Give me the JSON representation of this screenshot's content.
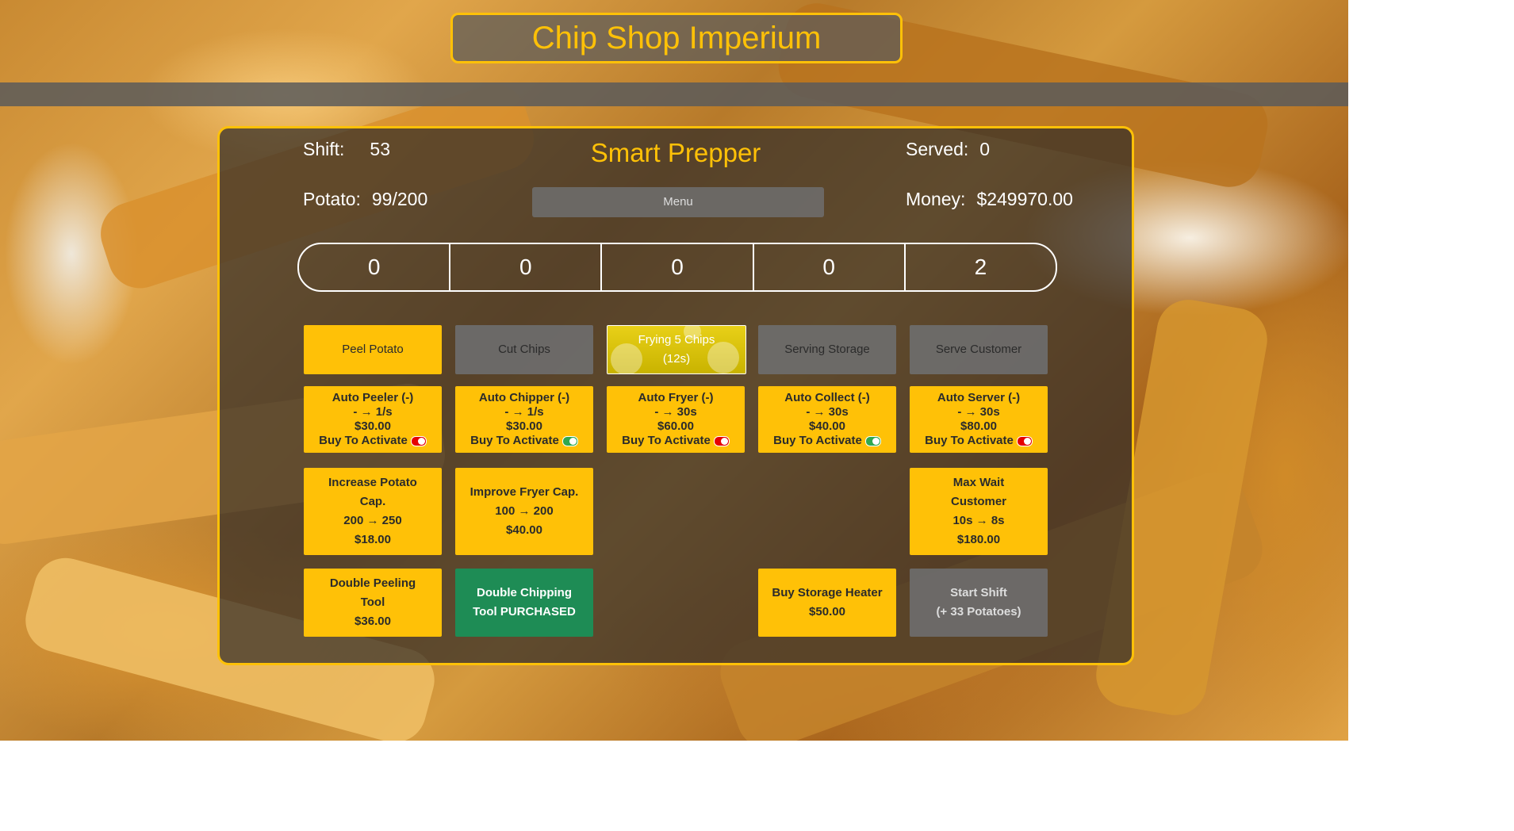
{
  "app": {
    "title": "Chip Shop Imperium"
  },
  "game": {
    "subtitle": "Smart Prepper",
    "shift_label": "Shift:",
    "shift_value": "53",
    "potato_label": "Potato:",
    "potato_value": "99/200",
    "served_label": "Served:",
    "served_value": "0",
    "money_label": "Money:",
    "money_value": "$249970.00",
    "menu_label": "Menu"
  },
  "counters": [
    "0",
    "0",
    "0",
    "0",
    "2"
  ],
  "actions": {
    "peel": "Peel Potato",
    "cut": "Cut Chips",
    "fry_line1": "Frying 5 Chips",
    "fry_line2": "(12s)",
    "storage": "Serving Storage",
    "serve": "Serve Customer"
  },
  "automation": [
    {
      "name": "Auto Peeler (-)",
      "rate": "- → 1/s",
      "price": "$30.00",
      "status": "Buy To Activate",
      "toggle": "red"
    },
    {
      "name": "Auto Chipper (-)",
      "rate": "- → 1/s",
      "price": "$30.00",
      "status": "Buy To Activate",
      "toggle": "green"
    },
    {
      "name": "Auto Fryer (-)",
      "rate": "- → 30s",
      "price": "$60.00",
      "status": "Buy To Activate",
      "toggle": "red"
    },
    {
      "name": "Auto Collect (-)",
      "rate": "- → 30s",
      "price": "$40.00",
      "status": "Buy To Activate",
      "toggle": "green"
    },
    {
      "name": "Auto Server (-)",
      "rate": "- → 30s",
      "price": "$80.00",
      "status": "Buy To Activate",
      "toggle": "red"
    }
  ],
  "upgrades": {
    "potato_cap": {
      "line1": "Increase Potato",
      "line2": "Cap.",
      "line3": "200 → 250",
      "price": "$18.00"
    },
    "fryer_cap": {
      "line1": "Improve Fryer Cap.",
      "line2": "100 → 200",
      "price": "$40.00"
    },
    "max_wait": {
      "line1": "Max Wait",
      "line2": "Customer",
      "line3": "10s → 8s",
      "price": "$180.00"
    },
    "double_peel": {
      "line1": "Double Peeling",
      "line2": "Tool",
      "price": "$36.00"
    },
    "double_chip": {
      "line1": "Double Chipping",
      "line2": "Tool PURCHASED"
    },
    "storage_heater": {
      "line1": "Buy Storage Heater",
      "price": "$50.00"
    },
    "start_shift": {
      "line1": "Start Shift",
      "line2": "(+ 33 Potatoes)"
    }
  },
  "colors": {
    "accent": "#ffc107",
    "purchased": "#1e8c55",
    "disabled": "#6e6e6e"
  }
}
